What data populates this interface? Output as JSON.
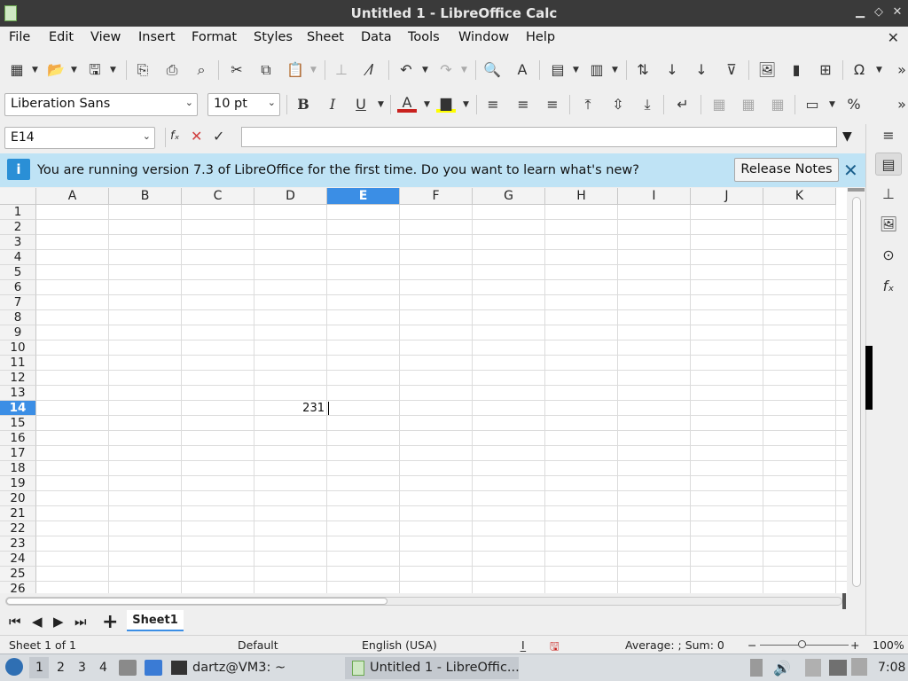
{
  "window": {
    "title": "Untitled 1 - LibreOffice Calc"
  },
  "menu": [
    "File",
    "Edit",
    "View",
    "Insert",
    "Format",
    "Styles",
    "Sheet",
    "Data",
    "Tools",
    "Window",
    "Help"
  ],
  "toolbar2": {
    "font_name": "Liberation Sans",
    "font_size": "10 pt"
  },
  "formula": {
    "cell_ref": "E14",
    "content": ""
  },
  "infobar": {
    "message": "You are running version 7.3 of LibreOffice for the first time. Do you want to learn what's new?",
    "button": "Release Notes",
    "accent": "#bfe3f5"
  },
  "grid": {
    "columns": [
      "A",
      "B",
      "C",
      "D",
      "E",
      "F",
      "G",
      "H",
      "I",
      "J",
      "K"
    ],
    "rows": [
      "1",
      "2",
      "3",
      "4",
      "5",
      "6",
      "7",
      "8",
      "9",
      "10",
      "11",
      "12",
      "13",
      "14",
      "15",
      "16",
      "17",
      "18",
      "19",
      "20",
      "21",
      "22",
      "23",
      "24",
      "25",
      "26"
    ],
    "active_col": "E",
    "active_row": "14",
    "cell_D14": "231"
  },
  "sheets": {
    "tab": "Sheet1"
  },
  "status": {
    "sheet": "Sheet 1 of 1",
    "style": "Default",
    "language": "English (USA)",
    "summary": "Average: ; Sum: 0",
    "zoom": "100%"
  },
  "taskbar": {
    "ws1": "1",
    "ws2": "2",
    "ws3": "3",
    "ws4": "4",
    "terminal": "dartz@VM3: ~",
    "app": "Untitled 1 - LibreOffic...",
    "clock": "7:08"
  }
}
